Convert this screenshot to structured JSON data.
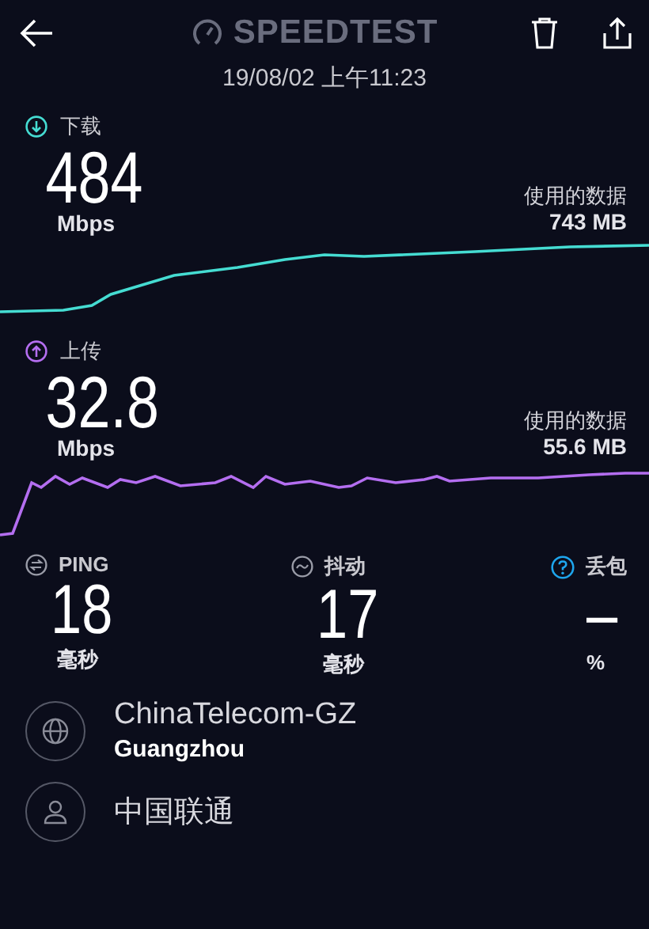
{
  "header": {
    "title": "SPEEDTEST",
    "date": "19/08/02 上午11:23"
  },
  "results": [
    {
      "kind": "download",
      "label": "下载",
      "value": "484",
      "unit": "Mbps",
      "data_label": "使用的数据",
      "data_value": "743 MB"
    },
    {
      "kind": "upload",
      "label": "上传",
      "value": "32.8",
      "unit": "Mbps",
      "data_label": "使用的数据",
      "data_value": "55.6 MB"
    }
  ],
  "stats": [
    {
      "kind": "ping",
      "label": "PING",
      "value": "18",
      "unit": "毫秒"
    },
    {
      "kind": "jitter",
      "label": "抖动",
      "value": "17",
      "unit": "毫秒"
    },
    {
      "kind": "loss",
      "label": "丢包",
      "value": "–",
      "unit": "%"
    }
  ],
  "servers": [
    {
      "kind": "host",
      "name": "ChinaTelecom-GZ",
      "location": "Guangzhou"
    },
    {
      "kind": "provider",
      "name": "中国联通"
    }
  ]
}
